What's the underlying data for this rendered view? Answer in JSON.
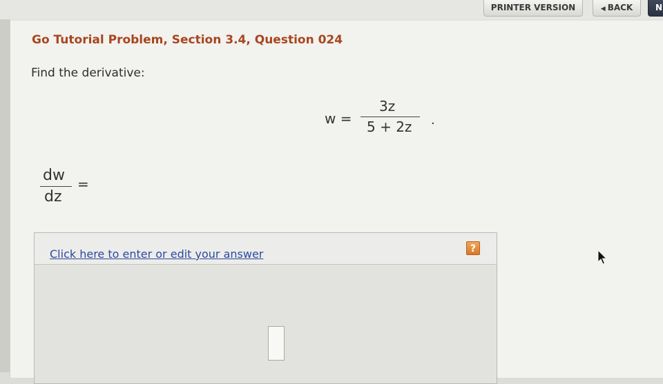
{
  "toolbar": {
    "printer_label": "PRINTER VERSION",
    "back_label": "BACK",
    "back_arrow": "◀",
    "next_label": "N"
  },
  "problem": {
    "title": "Go Tutorial Problem, Section 3.4, Question 024",
    "prompt": "Find the derivative:",
    "equation": {
      "lhs": "w =",
      "numerator": "3z",
      "denominator": "5 + 2z",
      "trailing": "."
    },
    "derivative": {
      "numerator": "dw",
      "denominator": "dz",
      "equals": "="
    }
  },
  "answer": {
    "link_label": "Click here to enter or edit your answer",
    "help_label": "?"
  },
  "colors": {
    "title": "#a8461e",
    "link": "#2a4aa0",
    "help_button": "#e08a3a"
  },
  "icons": {
    "back": "left-arrow-icon",
    "pointer": "mouse-cursor-icon"
  }
}
